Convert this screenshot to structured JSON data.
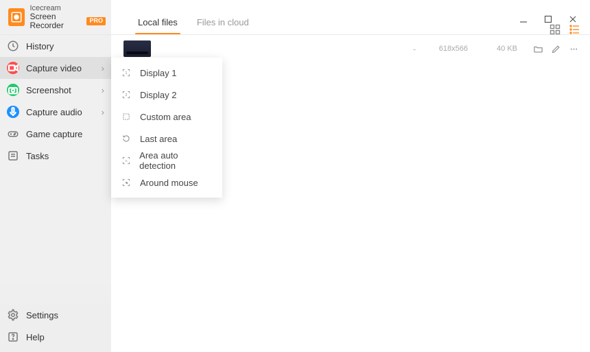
{
  "app": {
    "brand": "Icecream",
    "name": "Screen Recorder",
    "badge": "PRO"
  },
  "tabs": {
    "local": "Local files",
    "cloud": "Files in cloud"
  },
  "sidebar": {
    "history": "History",
    "capture_video": "Capture video",
    "screenshot": "Screenshot",
    "capture_audio": "Capture audio",
    "game_capture": "Game capture",
    "tasks": "Tasks",
    "settings": "Settings",
    "help": "Help"
  },
  "submenu": {
    "display1": "Display 1",
    "display2": "Display 2",
    "custom_area": "Custom area",
    "last_area": "Last area",
    "auto_detect": "Area auto detection",
    "around_mouse": "Around mouse"
  },
  "file": {
    "name": "",
    "dash": "-",
    "dims": "618x566",
    "size": "40 KB"
  }
}
